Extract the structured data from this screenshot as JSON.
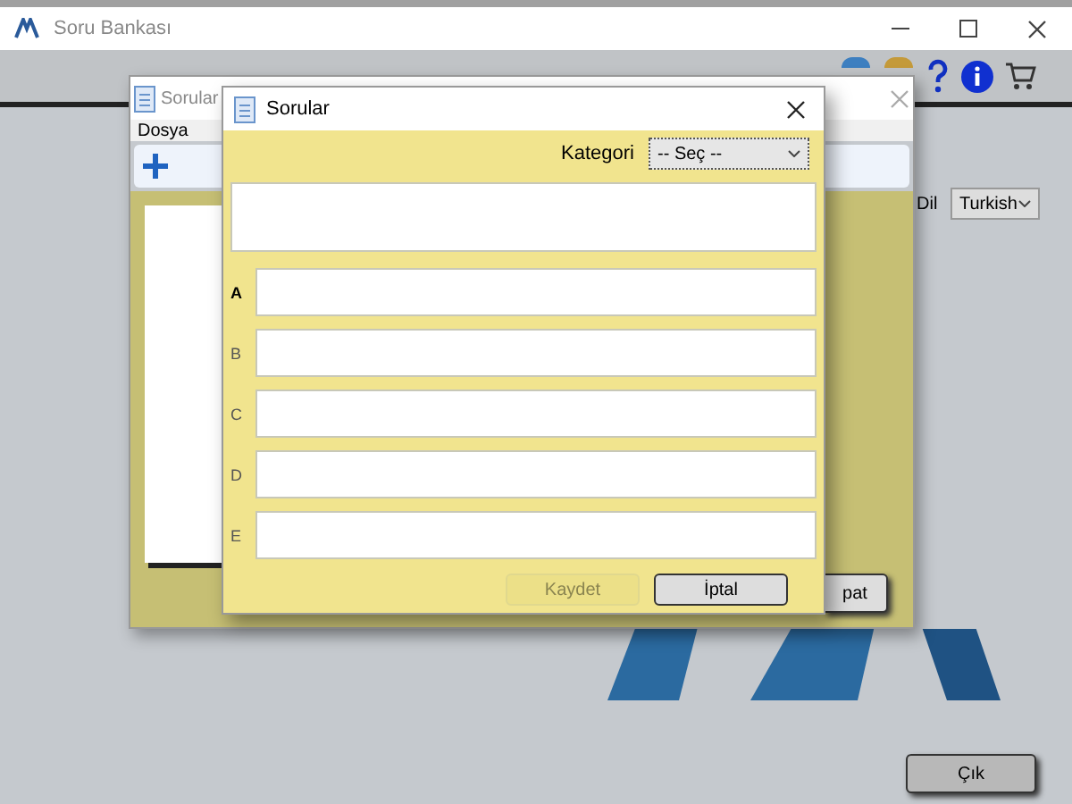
{
  "main_window": {
    "title": "Soru Bankası",
    "language_label": "Dil",
    "language": "Turkish",
    "exit_button": "Çık"
  },
  "back_window": {
    "title": "Sorular",
    "menu": [
      "Dosya"
    ],
    "partial_button": "pat"
  },
  "dialog": {
    "title": "Sorular",
    "category_label": "Kategori",
    "category": "-- Seç --",
    "options": [
      {
        "letter": "A",
        "selected": true
      },
      {
        "letter": "B",
        "selected": false
      },
      {
        "letter": "C",
        "selected": false
      },
      {
        "letter": "D",
        "selected": false
      },
      {
        "letter": "E",
        "selected": false
      }
    ],
    "buttons": [
      {
        "label": "Kaydet",
        "disabled": true
      },
      {
        "label": "İptal",
        "disabled": false
      }
    ]
  }
}
